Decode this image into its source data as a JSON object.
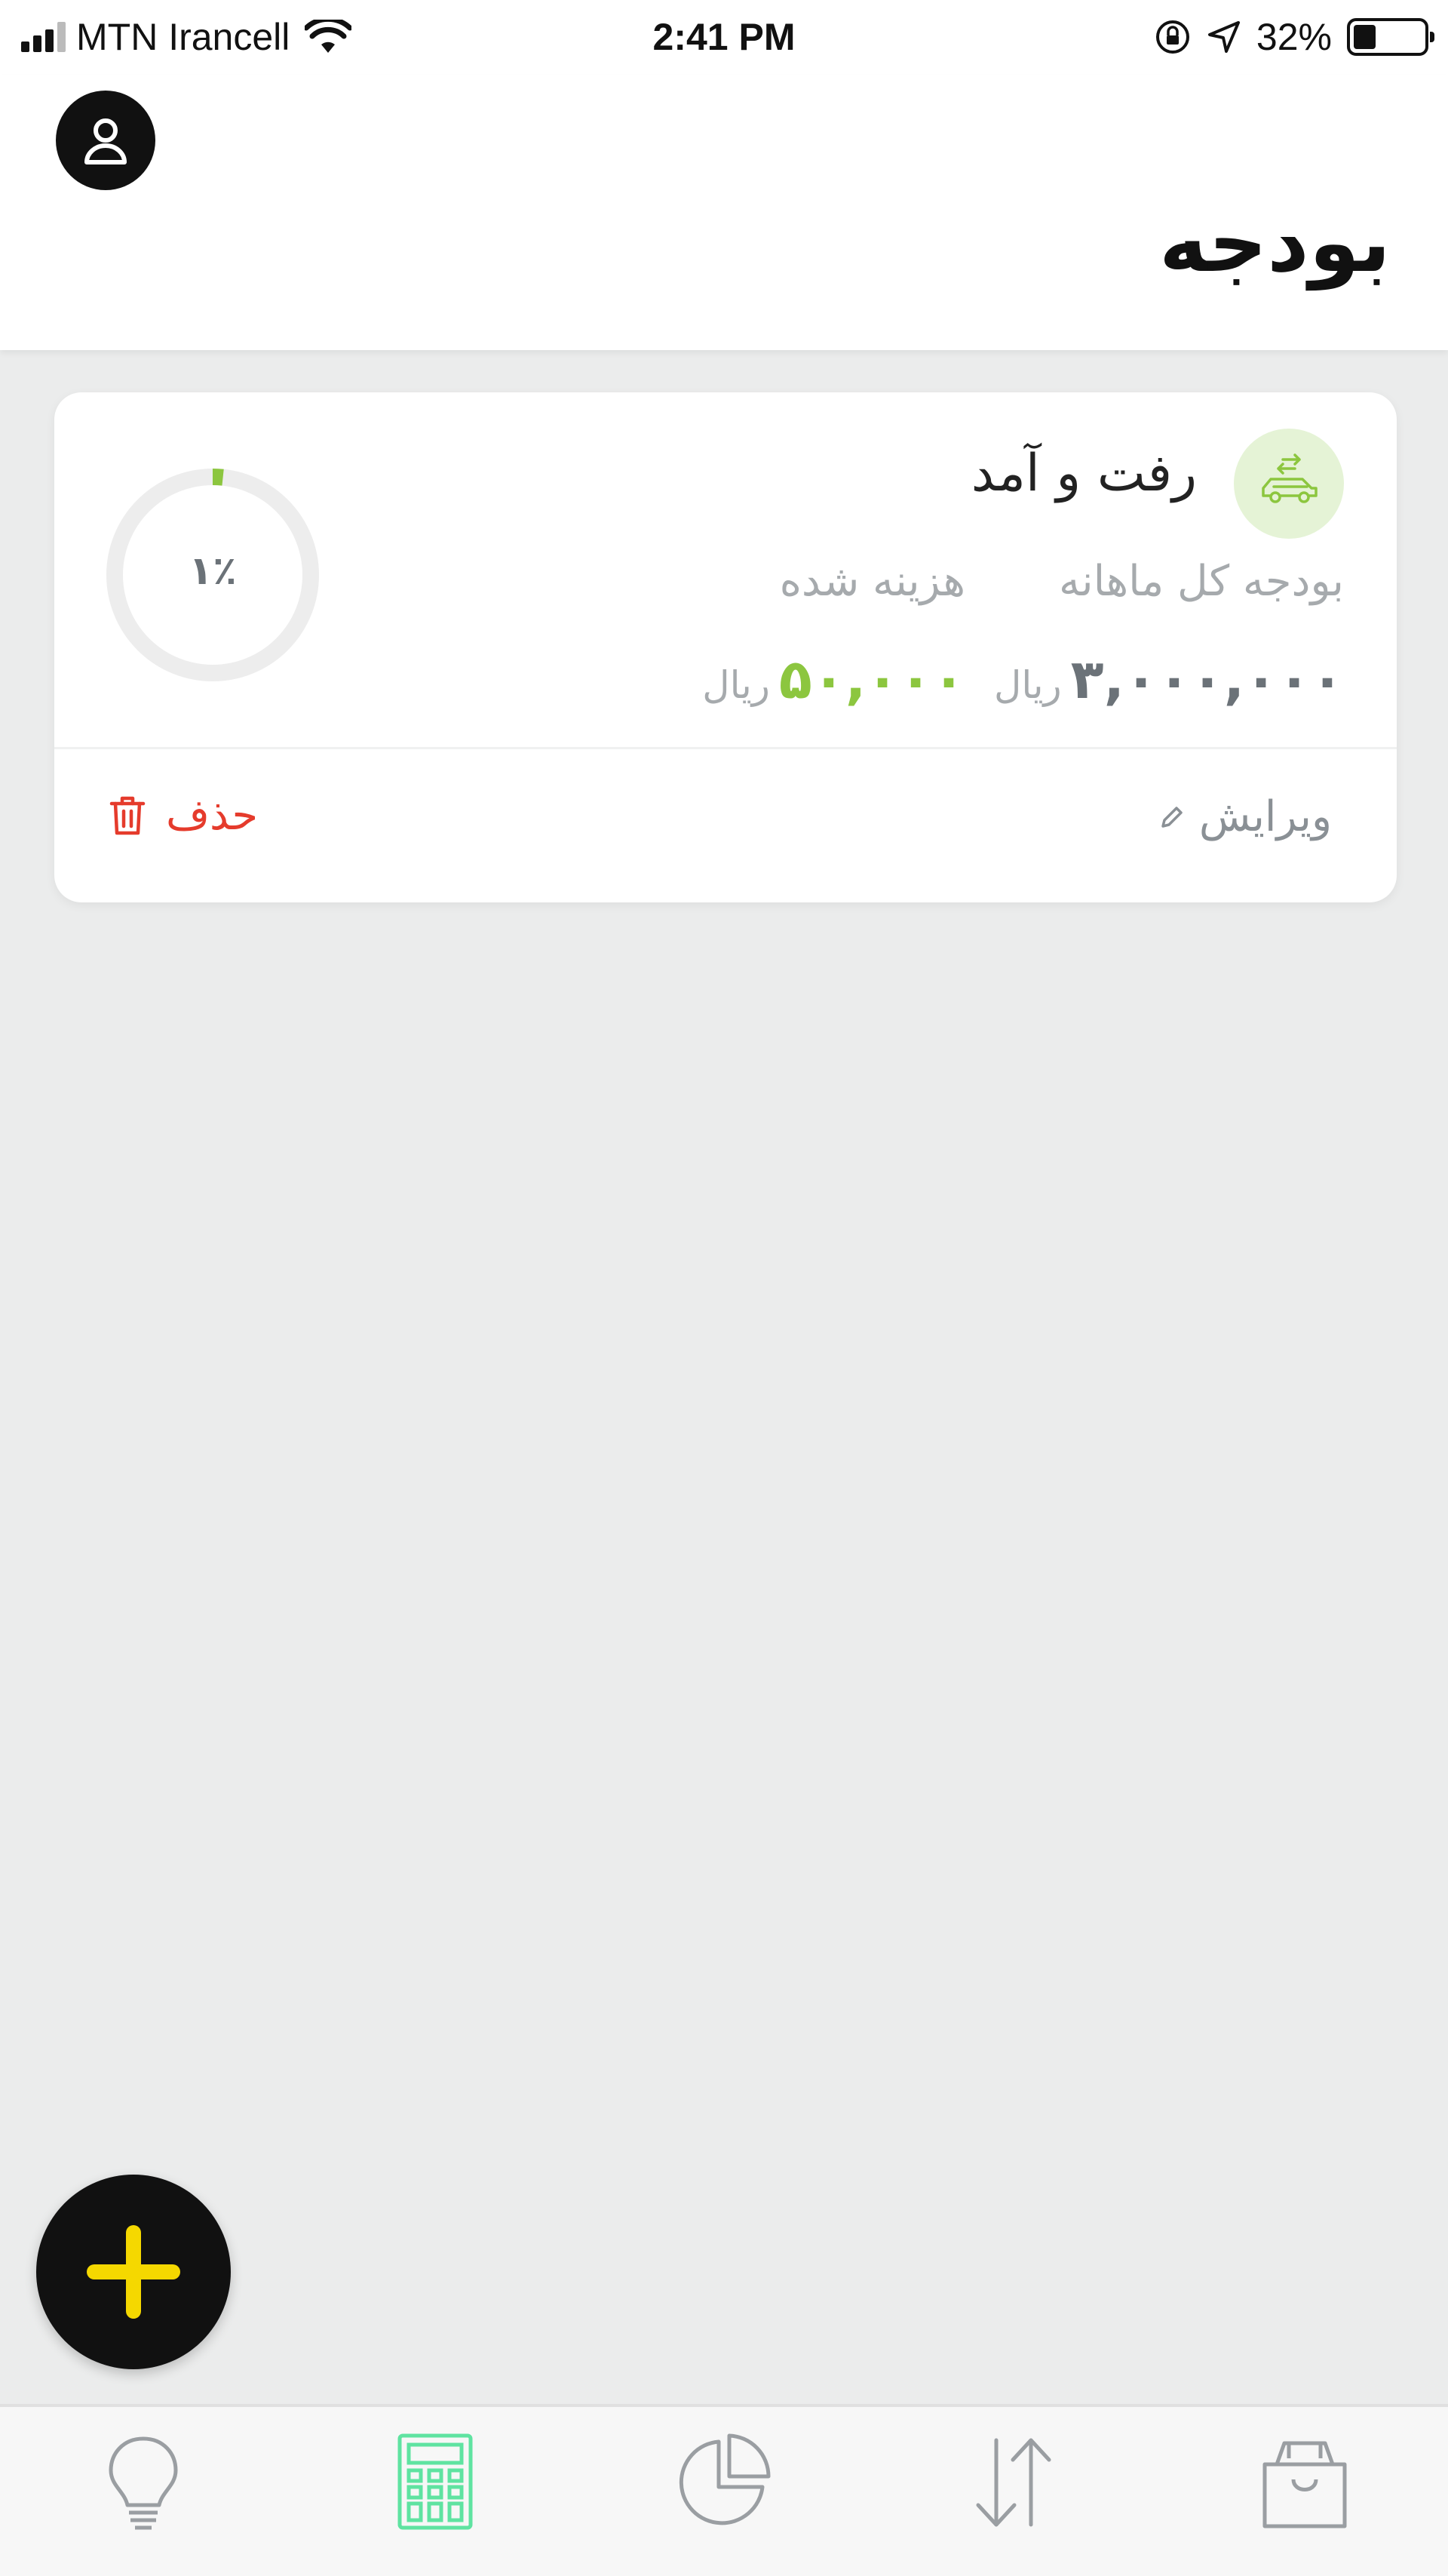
{
  "status_bar": {
    "carrier": "MTN Irancell",
    "time": "2:41 PM",
    "battery_percent": "32%",
    "battery_level": 0.32,
    "icons": [
      "signal-icon",
      "wifi-icon",
      "orientation-lock-icon",
      "location-arrow-icon",
      "battery-icon"
    ]
  },
  "header": {
    "title": "بودجه",
    "avatar_icon": "user-icon"
  },
  "budget_card": {
    "category_name": "رفت و آمد",
    "category_icon": "car-icon",
    "label_total": "بودجه کل ماهانه",
    "label_spent": "هزینه شده",
    "total_amount": "۳,۰۰۰,۰۰۰",
    "spent_amount": "۵۰,۰۰۰",
    "currency": "ریال",
    "progress_text": "۱٪",
    "progress_fraction": 0.0167,
    "edit_label": "ویرایش",
    "delete_label": "حذف",
    "colors": {
      "spent": "#8cc63f",
      "delete": "#e53b2c",
      "icon_bg": "#e5f3d6"
    }
  },
  "fab": {
    "icon": "plus-icon",
    "color": "#f5d800"
  },
  "bottom_nav": {
    "items": [
      {
        "icon": "lightbulb-icon",
        "active": false
      },
      {
        "icon": "calculator-icon",
        "active": true
      },
      {
        "icon": "pie-chart-icon",
        "active": false
      },
      {
        "icon": "transfer-arrows-icon",
        "active": false
      },
      {
        "icon": "shopping-bag-icon",
        "active": false
      }
    ],
    "active_color": "#5fe3a1"
  }
}
